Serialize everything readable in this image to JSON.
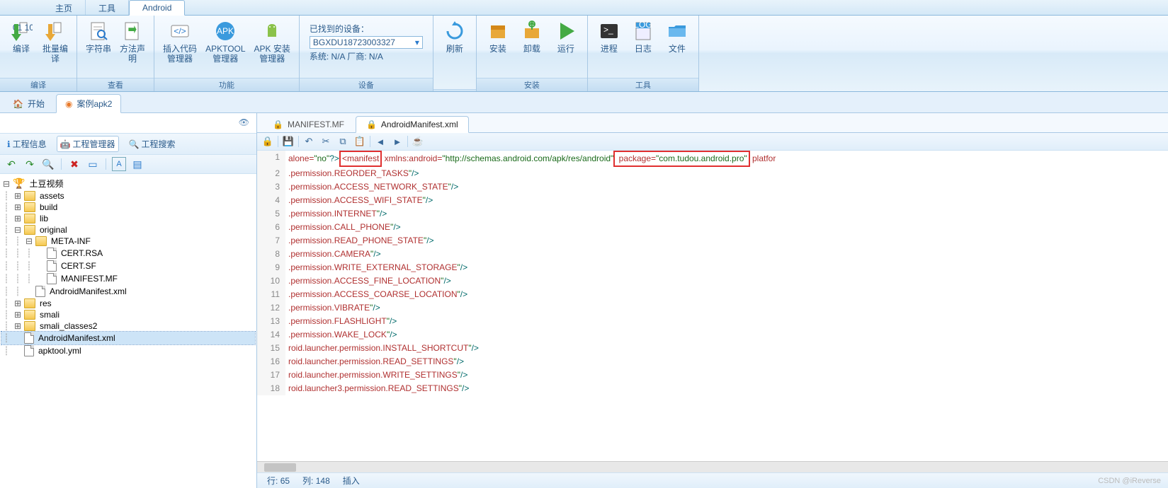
{
  "menu_tabs": [
    "主页",
    "工具",
    "Android"
  ],
  "active_menu_tab": 2,
  "ribbon": {
    "groups": [
      {
        "title": "编译",
        "buttons": [
          {
            "label": "编译",
            "icon": "arrow-down-green"
          },
          {
            "label": "批量编\n译",
            "icon": "arrow-down-orange"
          }
        ]
      },
      {
        "title": "查看",
        "buttons": [
          {
            "label": "字符串",
            "icon": "magnify-doc"
          },
          {
            "label": "方法声\n明",
            "icon": "doc-arrow"
          }
        ]
      },
      {
        "title": "功能",
        "buttons": [
          {
            "label": "插入代码\n管理器",
            "icon": "code-tag"
          },
          {
            "label": "APKTOOL\n管理器",
            "icon": "apk-blue"
          },
          {
            "label": "APK 安装\n管理器",
            "icon": "android-green"
          }
        ]
      },
      {
        "title": "设备",
        "device": {
          "found_label": "已找到的设备：",
          "selected": "BGXDU18723003327",
          "sys_label": "系统: N/A  厂商: N/A"
        }
      },
      {
        "title": "",
        "buttons": [
          {
            "label": "刷新",
            "icon": "refresh-blue"
          }
        ]
      },
      {
        "title": "安装",
        "buttons": [
          {
            "label": "安装",
            "icon": "box-orange"
          },
          {
            "label": "卸载",
            "icon": "recycle"
          },
          {
            "label": "运行",
            "icon": "play-green"
          }
        ]
      },
      {
        "title": "工具",
        "buttons": [
          {
            "label": "进程",
            "icon": "terminal"
          },
          {
            "label": "日志",
            "icon": "log"
          },
          {
            "label": "文件",
            "icon": "folder-blue"
          }
        ]
      }
    ]
  },
  "doc_tabs": [
    {
      "label": "开始",
      "icon": "home"
    },
    {
      "label": "案例apk2",
      "icon": "apk-orange"
    }
  ],
  "active_doc_tab": 1,
  "sidebar": {
    "tabs": [
      {
        "label": "工程信息",
        "icon": "info"
      },
      {
        "label": "工程管理器",
        "icon": "android"
      },
      {
        "label": "工程搜索",
        "icon": "search"
      }
    ],
    "active_tab": 1,
    "root": "土豆视频",
    "tree": [
      {
        "d": 0,
        "tw": "⊟",
        "type": "root",
        "label": "土豆视频"
      },
      {
        "d": 1,
        "tw": "⊞",
        "type": "folder",
        "label": "assets"
      },
      {
        "d": 1,
        "tw": "⊞",
        "type": "folder",
        "label": "build"
      },
      {
        "d": 1,
        "tw": "⊞",
        "type": "folder",
        "label": "lib"
      },
      {
        "d": 1,
        "tw": "⊟",
        "type": "folder",
        "label": "original"
      },
      {
        "d": 2,
        "tw": "⊟",
        "type": "folder",
        "label": "META-INF"
      },
      {
        "d": 3,
        "tw": "",
        "type": "file",
        "label": "CERT.RSA"
      },
      {
        "d": 3,
        "tw": "",
        "type": "file",
        "label": "CERT.SF"
      },
      {
        "d": 3,
        "tw": "",
        "type": "file",
        "label": "MANIFEST.MF"
      },
      {
        "d": 2,
        "tw": "",
        "type": "file",
        "label": "AndroidManifest.xml"
      },
      {
        "d": 1,
        "tw": "⊞",
        "type": "folder",
        "label": "res"
      },
      {
        "d": 1,
        "tw": "⊞",
        "type": "folder",
        "label": "smali"
      },
      {
        "d": 1,
        "tw": "⊞",
        "type": "folder",
        "label": "smali_classes2"
      },
      {
        "d": 1,
        "tw": "",
        "type": "file",
        "label": "AndroidManifest.xml",
        "sel": true
      },
      {
        "d": 1,
        "tw": "",
        "type": "file",
        "label": "apktool.yml"
      }
    ]
  },
  "file_tabs": [
    {
      "label": "MANIFEST.MF",
      "icon": "lock"
    },
    {
      "label": "AndroidManifest.xml",
      "icon": "lock"
    }
  ],
  "active_file_tab": 1,
  "code": {
    "line1_prefix": "alone=",
    "line1_no": "\"no\"",
    "line1_q": "?>",
    "line1_manifest": "<manifest",
    "line1_mid": " xmlns:android=",
    "line1_url": "\"http://schemas.android.com/apk/res/android\"",
    "line1_pkgkey": " package=",
    "line1_pkgval": "\"com.tudou.android.pro\"",
    "line1_tail": " platfor",
    "perms": [
      ".permission.REORDER_TASKS",
      ".permission.ACCESS_NETWORK_STATE",
      ".permission.ACCESS_WIFI_STATE",
      ".permission.INTERNET",
      ".permission.CALL_PHONE",
      ".permission.READ_PHONE_STATE",
      ".permission.CAMERA",
      ".permission.WRITE_EXTERNAL_STORAGE",
      ".permission.ACCESS_FINE_LOCATION",
      ".permission.ACCESS_COARSE_LOCATION",
      ".permission.VIBRATE",
      ".permission.FLASHLIGHT",
      ".permission.WAKE_LOCK",
      "roid.launcher.permission.INSTALL_SHORTCUT",
      "roid.launcher.permission.READ_SETTINGS",
      "roid.launcher.permission.WRITE_SETTINGS",
      "roid.launcher3.permission.READ_SETTINGS"
    ],
    "close": "\"/>"
  },
  "status": {
    "line_lbl": "行:",
    "line_val": "65",
    "col_lbl": "列:",
    "col_val": "148",
    "mode": "插入"
  },
  "watermark": "CSDN @iReverse"
}
